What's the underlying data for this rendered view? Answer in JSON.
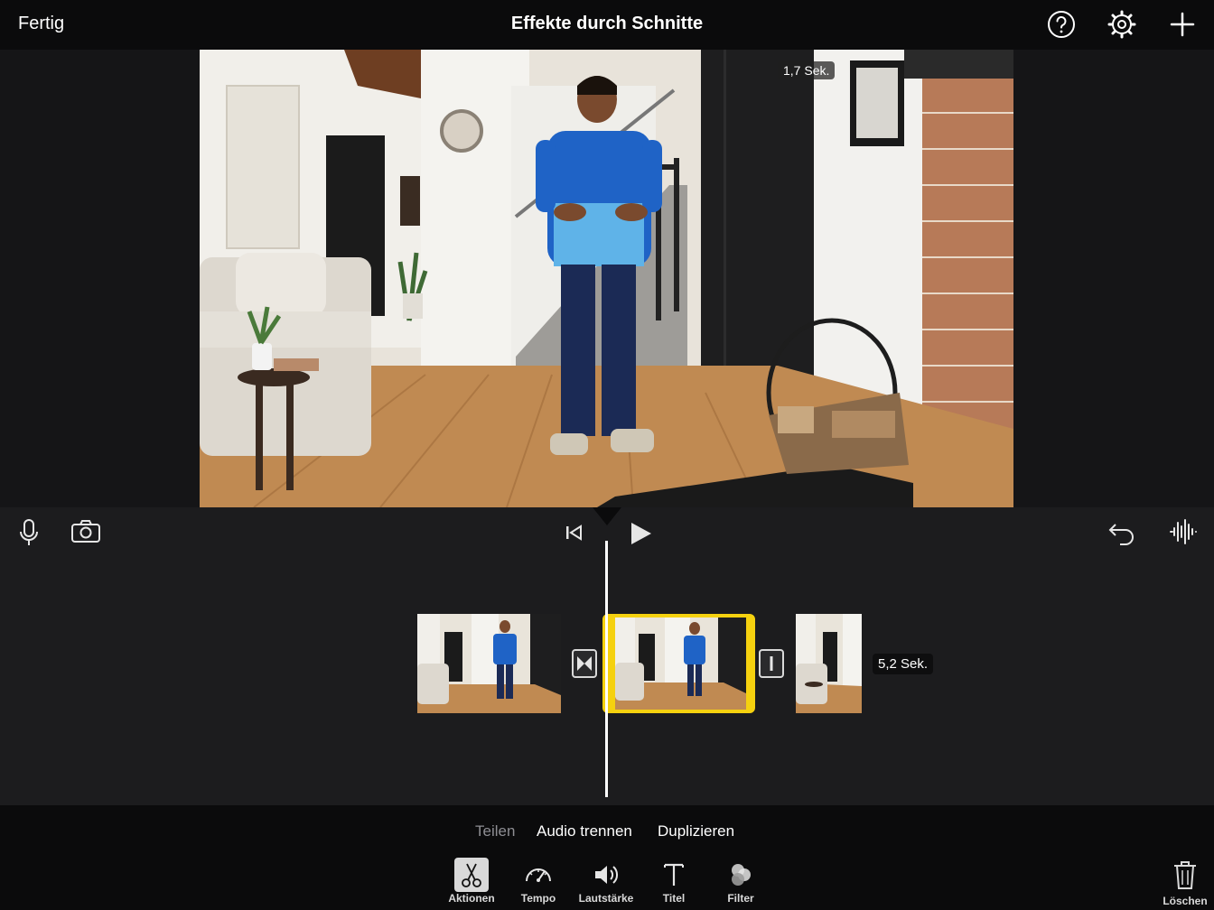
{
  "header": {
    "done_label": "Fertig",
    "title": "Effekte durch Schnitte"
  },
  "viewer": {
    "time_badge": "1,7 Sek."
  },
  "timeline": {
    "duration_badge": "5,2 Sek."
  },
  "actions": {
    "split_label": "Teilen",
    "detach_audio_label": "Audio trennen",
    "duplicate_label": "Duplizieren"
  },
  "toolbar": {
    "items": [
      {
        "label": "Aktionen",
        "icon": "scissors-icon"
      },
      {
        "label": "Tempo",
        "icon": "speedometer-icon"
      },
      {
        "label": "Lautstärke",
        "icon": "speaker-icon"
      },
      {
        "label": "Titel",
        "icon": "text-icon"
      },
      {
        "label": "Filter",
        "icon": "filter-circles-icon"
      }
    ],
    "delete_label": "Löschen"
  },
  "colors": {
    "selection": "#f5d10f",
    "background": "#1c1c1e",
    "bar": "#0b0b0c"
  }
}
